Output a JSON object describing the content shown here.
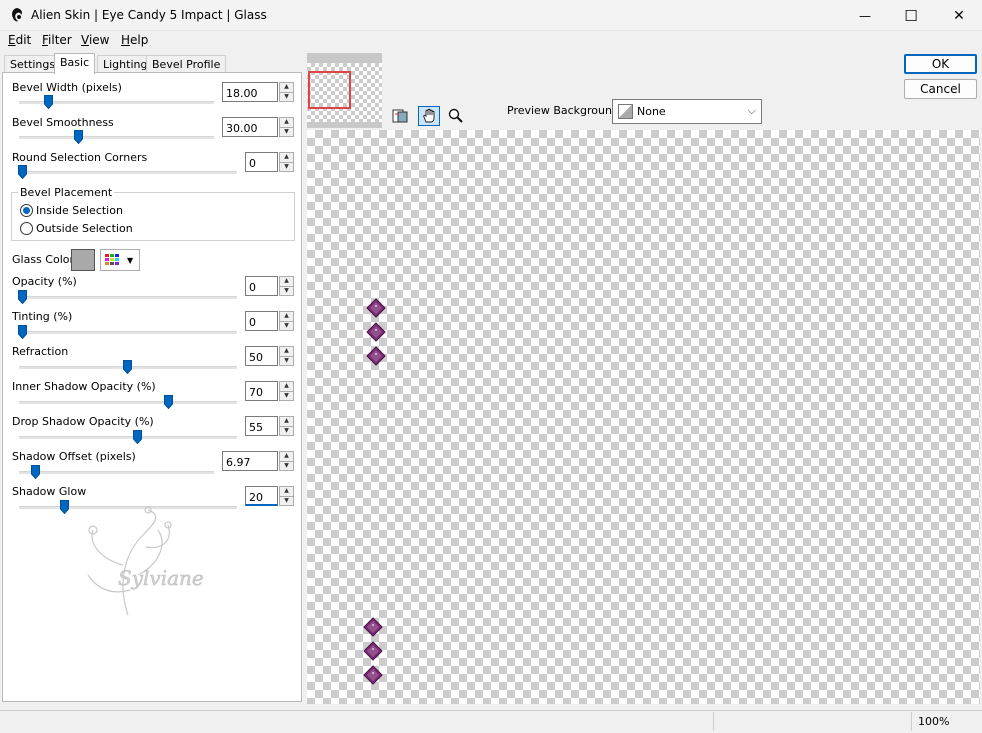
{
  "window": {
    "title": "Alien Skin | Eye Candy 5 Impact | Glass",
    "minimize": "—",
    "maximize": "☐",
    "close": "✕"
  },
  "menu": [
    "Edit",
    "Filter",
    "View",
    "Help"
  ],
  "tabs": [
    "Settings",
    "Basic",
    "Lighting",
    "Bevel Profile"
  ],
  "params": {
    "bevel_width": {
      "label": "Bevel Width (pixels)",
      "value": "18.00",
      "level": 0.14
    },
    "bevel_smoothness": {
      "label": "Bevel Smoothness",
      "value": "30.00",
      "level": 0.3
    },
    "round_corners": {
      "label": "Round Selection Corners",
      "value": "0",
      "level": 0.0
    },
    "bevel_placement": {
      "title": "Bevel Placement",
      "inside": "Inside Selection",
      "outside": "Outside Selection",
      "selected": "inside"
    },
    "glass_color": {
      "label": "Glass Color",
      "color": "#a9a9a9"
    },
    "opacity": {
      "label": "Opacity (%)",
      "value": "0",
      "level": 0.0
    },
    "tinting": {
      "label": "Tinting (%)",
      "value": "0",
      "level": 0.0
    },
    "refraction": {
      "label": "Refraction",
      "value": "50",
      "level": 0.5
    },
    "inner_shadow": {
      "label": "Inner Shadow Opacity (%)",
      "value": "70",
      "level": 0.7
    },
    "drop_shadow": {
      "label": "Drop Shadow Opacity (%)",
      "value": "55",
      "level": 0.55
    },
    "shadow_offset": {
      "label": "Shadow Offset (pixels)",
      "value": "6.97",
      "level": 0.07
    },
    "shadow_glow": {
      "label": "Shadow Glow",
      "value": "20",
      "level": 0.2
    }
  },
  "watermark": "Sylviane",
  "preview": {
    "background_label": "Preview Background:",
    "background_value": "None",
    "gem_color": "#7b2a76"
  },
  "buttons": {
    "ok": "OK",
    "cancel": "Cancel"
  },
  "status": {
    "zoom": "100%"
  }
}
